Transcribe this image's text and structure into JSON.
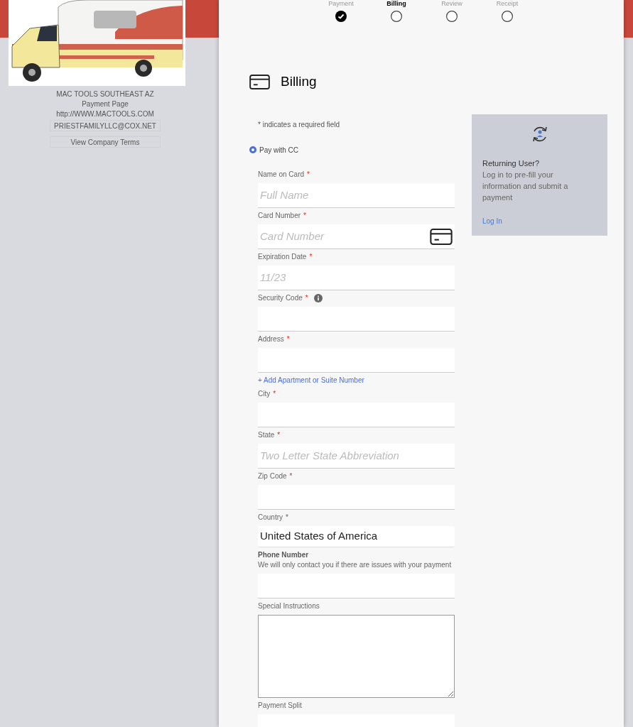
{
  "sidebar": {
    "company": "MAC TOOLS SOUTHEAST AZ",
    "page_title": "Payment Page",
    "website": "http://WWW.MACTOOLS.COM",
    "email_button": "PRIESTFAMILYLLC@COX.NET",
    "terms_button": "View Company Terms"
  },
  "steps": [
    {
      "label": "Payment",
      "completed": true,
      "selected": false
    },
    {
      "label": "Billing",
      "completed": false,
      "selected": true
    },
    {
      "label": "Review",
      "completed": false,
      "selected": false
    },
    {
      "label": "Receipt",
      "completed": false,
      "selected": false
    }
  ],
  "heading": "Billing",
  "required_note": "* indicates a required field",
  "payment_method": {
    "label": "Pay with CC",
    "selected": true
  },
  "fields": [
    {
      "kind": "input",
      "label": "Name on Card",
      "required_mark": "*",
      "placeholder": "Full Name"
    },
    {
      "kind": "input",
      "label": "Card Number",
      "required_mark": "*",
      "placeholder": "Card Number",
      "card_icon": true
    },
    {
      "kind": "input",
      "label": "Expiration Date",
      "required_mark": "*",
      "placeholder": "11/23"
    },
    {
      "kind": "input",
      "label": "Security Code",
      "required_mark": "*",
      "info_icon": true
    },
    {
      "kind": "input",
      "label": "Address",
      "required_mark": "*"
    },
    {
      "kind": "link",
      "label": "+ Add Apartment or Suite Number"
    },
    {
      "kind": "input",
      "label": "City",
      "required_mark": "*"
    },
    {
      "kind": "input",
      "label": "State",
      "required_mark": "*",
      "placeholder": "Two Letter State Abbreviation"
    },
    {
      "kind": "input",
      "label": "Zip Code",
      "required_mark": "*"
    },
    {
      "kind": "select",
      "label": "Country",
      "required_mark": "*",
      "value": "United States of America"
    },
    {
      "kind": "input",
      "label": "Phone Number",
      "help": "We will only contact you if there are issues with your payment"
    },
    {
      "kind": "textarea",
      "label": "Special Instructions"
    },
    {
      "kind": "input",
      "label": "Payment Split"
    }
  ],
  "returning_user": {
    "title": "Returning User?",
    "text": "Log in to pre-fill your information and submit a payment",
    "link": "Log In"
  }
}
